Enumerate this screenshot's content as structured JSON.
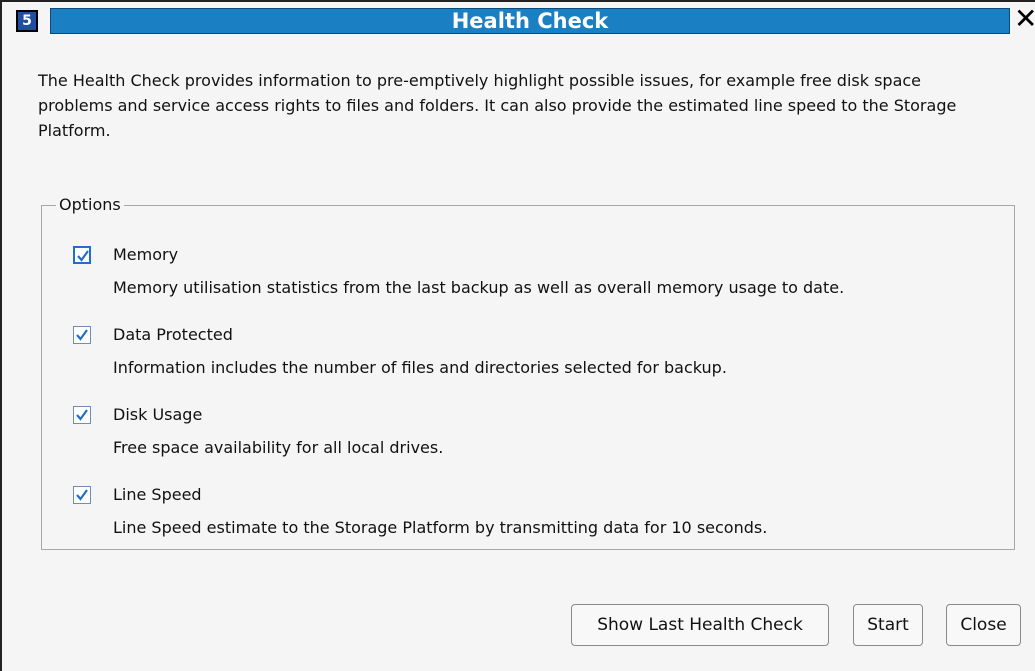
{
  "window": {
    "title": "Health Check",
    "app_icon_text": "5",
    "close_glyph": "✕"
  },
  "description": "The Health Check provides information to pre-emptively highlight possible issues, for example free disk space problems and service access rights to files and folders. It can also provide the estimated line speed to the Storage Platform.",
  "options": {
    "legend": "Options",
    "items": [
      {
        "label": "Memory",
        "description": "Memory utilisation statistics from the last backup as well as overall memory usage to date.",
        "checked": true,
        "focused": true
      },
      {
        "label": "Data Protected",
        "description": "Information includes the number of files and directories selected for backup.",
        "checked": true,
        "focused": false
      },
      {
        "label": "Disk Usage",
        "description": "Free space availability for all local drives.",
        "checked": true,
        "focused": false
      },
      {
        "label": "Line Speed",
        "description": "Line Speed estimate to the Storage Platform by transmitting data for 10 seconds.",
        "checked": true,
        "focused": false
      }
    ]
  },
  "buttons": {
    "show_last": "Show Last Health Check",
    "start": "Start",
    "close": "Close"
  },
  "colors": {
    "title_bar": "#1a7fc3",
    "check_mark": "#1e6fd0"
  },
  "icons": {
    "app": "app-icon",
    "close": "close-icon",
    "check": "checkmark-icon"
  }
}
